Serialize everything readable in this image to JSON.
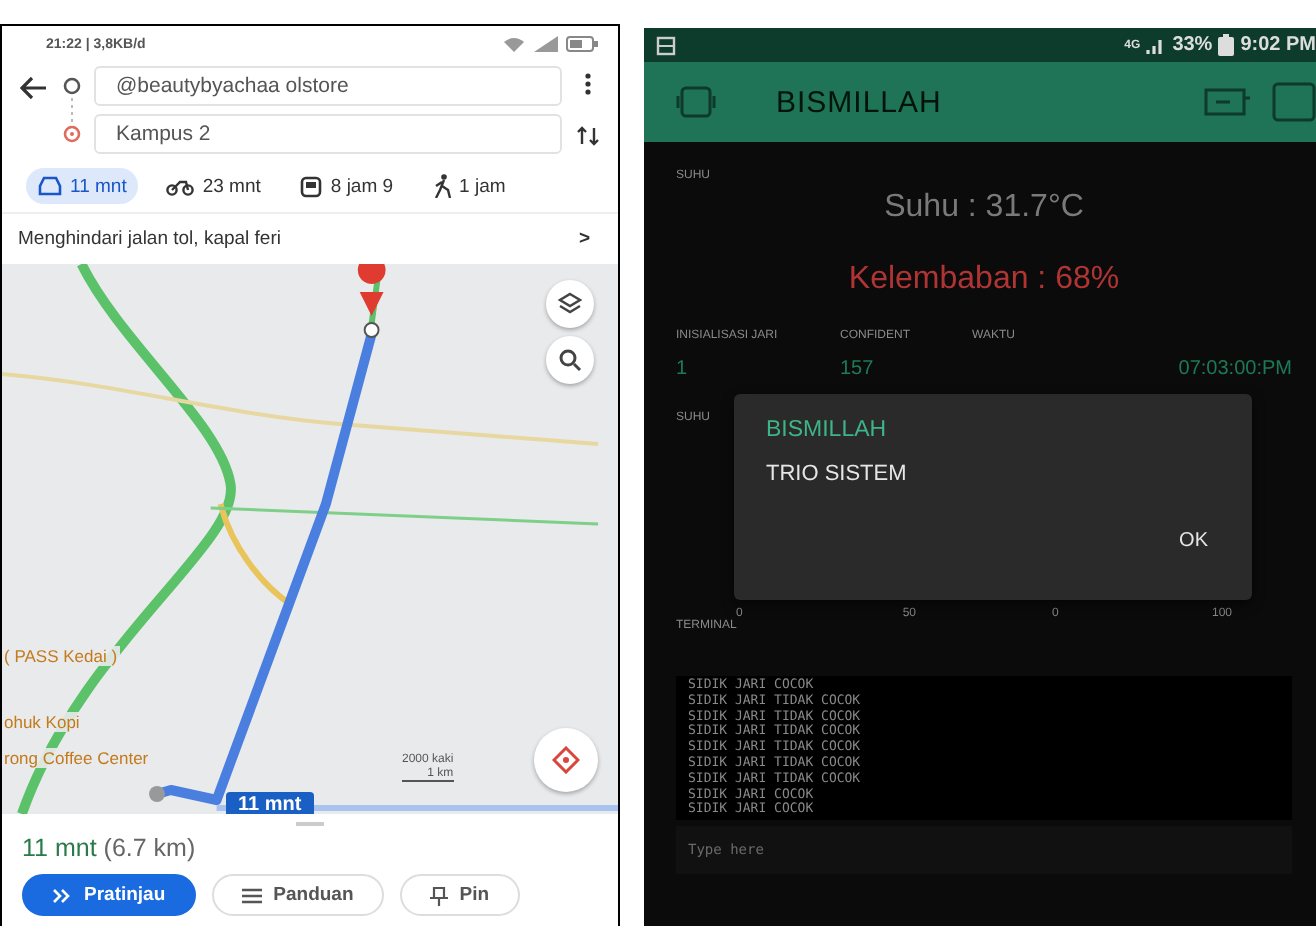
{
  "maps": {
    "status_bar": {
      "text": "21:22 | 3,8KB/d"
    },
    "origin": {
      "value": "@beautybyachaa olstore"
    },
    "destination": {
      "value": "Kampus 2"
    },
    "modes": [
      {
        "kind": "car",
        "label": "11 mnt",
        "selected": true
      },
      {
        "kind": "motorbike",
        "label": "23 mnt",
        "selected": false
      },
      {
        "kind": "transit",
        "label": "8 jam 9",
        "selected": false
      },
      {
        "kind": "walk",
        "label": "1 jam",
        "selected": false
      }
    ],
    "route_option": {
      "label": "Menghindari jalan tol, kapal feri",
      "chevron": ">"
    },
    "map": {
      "labels": [
        "( PASS Kedai )",
        "ohuk Kopi",
        "rong Coffee Center"
      ],
      "scale": [
        "2000 kaki",
        "1 km"
      ],
      "route_label": "11 mnt"
    },
    "summary": {
      "time": "11 mnt",
      "distance": "(6.7 km)"
    },
    "buttons": [
      {
        "kind": "start",
        "label": "Pratinjau",
        "selected": true
      },
      {
        "kind": "steps",
        "label": "Panduan",
        "selected": false
      },
      {
        "kind": "pin",
        "label": "Pin",
        "selected": false
      }
    ]
  },
  "blynk": {
    "status_bar": {
      "network": "4G",
      "battery": "33%",
      "time": "9:02 PM"
    },
    "title": "BISMILLAH",
    "suhu_label": "SUHU",
    "temperature": "Suhu : 31.7°C",
    "humidity": "Kelembaban : 68%",
    "table": {
      "columns": [
        "INISIALISASI JARI",
        "CONFIDENT",
        "WAKTU"
      ],
      "values": [
        "1",
        "157",
        "07:03:00:PM"
      ]
    },
    "gauge_label": "SUHU",
    "gauges": [
      {
        "min": "0",
        "max": "50"
      },
      {
        "min": "0",
        "max": "100"
      }
    ],
    "terminal": {
      "label": "TERMINAL",
      "lines": [
        "SIDIK JARI COCOK",
        "SIDIK JARI TIDAK COCOK",
        "SIDIK JARI TIDAK COCOK",
        "SIDIK JARI TIDAK COCOK",
        "SIDIK JARI TIDAK COCOK",
        "SIDIK JARI TIDAK COCOK",
        "SIDIK JARI TIDAK COCOK",
        "SIDIK JARI COCOK",
        "SIDIK JARI COCOK"
      ],
      "placeholder": "Type here"
    },
    "dialog": {
      "title": "BISMILLAH",
      "message": "TRIO SISTEM",
      "button": "OK"
    }
  }
}
